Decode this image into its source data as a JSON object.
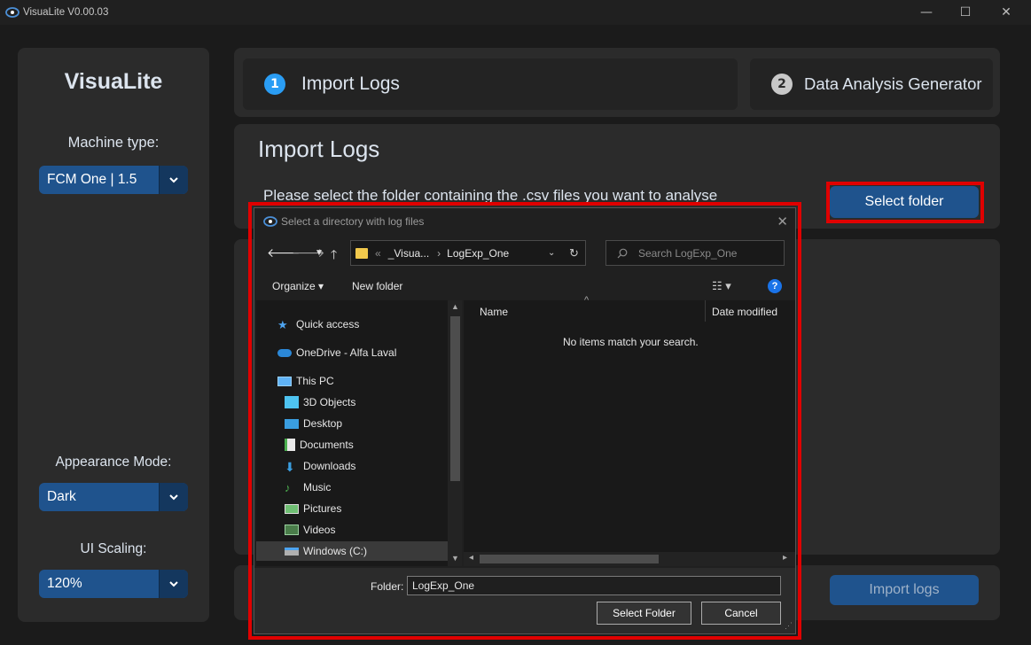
{
  "window": {
    "title": "VisuaLite V0.00.03",
    "controls": {
      "minimize": "—",
      "maximize": "☐",
      "close": "✕"
    }
  },
  "sidebar": {
    "logo": "VisuaLite",
    "machine_type_label": "Machine type:",
    "machine_type_value": "FCM One | 1.5",
    "appearance_label": "Appearance Mode:",
    "appearance_value": "Dark",
    "scaling_label": "UI Scaling:",
    "scaling_value": "120%"
  },
  "tabs": [
    {
      "num": "1",
      "label": "Import Logs"
    },
    {
      "num": "2",
      "label": "Data Analysis Generator"
    }
  ],
  "import_panel": {
    "heading": "Import Logs",
    "instruction": "Please select the folder containing the .csv files you want to analyse",
    "select_folder_button": "Select folder",
    "import_logs_button": "Import logs"
  },
  "dialog": {
    "title": "Select a directory with log files",
    "close": "✕",
    "address": {
      "overflow": "«",
      "crumbs": [
        "_Visua...",
        "LogExp_One"
      ],
      "separator": "›"
    },
    "search_placeholder": "Search LogExp_One",
    "toolbar": {
      "organize": "Organize ▾",
      "new_folder": "New folder",
      "help": "?"
    },
    "nav_items": [
      {
        "label": "Quick access",
        "icon": "star-icon"
      },
      {
        "label": "OneDrive - Alfa Laval",
        "icon": "cloud-icon"
      },
      {
        "label": "This PC",
        "icon": "computer-icon"
      },
      {
        "label": "3D Objects",
        "icon": "cube-icon"
      },
      {
        "label": "Desktop",
        "icon": "desktop-icon"
      },
      {
        "label": "Documents",
        "icon": "document-icon"
      },
      {
        "label": "Downloads",
        "icon": "download-icon"
      },
      {
        "label": "Music",
        "icon": "music-icon"
      },
      {
        "label": "Pictures",
        "icon": "picture-icon"
      },
      {
        "label": "Videos",
        "icon": "video-icon"
      },
      {
        "label": "Windows (C:)",
        "icon": "drive-icon"
      }
    ],
    "columns": {
      "name": "Name",
      "date_modified": "Date modified"
    },
    "empty_message": "No items match your search.",
    "folder_label": "Folder:",
    "folder_value": "LogExp_One",
    "select_button": "Select Folder",
    "cancel_button": "Cancel"
  },
  "colors": {
    "accent": "#1f538d",
    "accent_dark": "#14375e",
    "highlight_border": "#e00000",
    "panel": "#2b2b2b"
  }
}
